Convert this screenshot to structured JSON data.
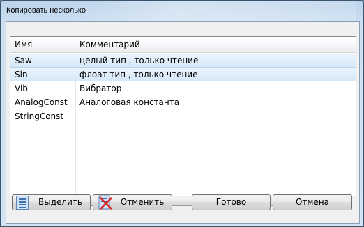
{
  "window": {
    "title": "Копировать несколько"
  },
  "grid": {
    "columns": [
      "Имя",
      "Комментарий"
    ],
    "rows": [
      {
        "name": "Saw",
        "comment": "целый тип , только чтение",
        "selected": true
      },
      {
        "name": "Sin",
        "comment": "флоат тип , только чтение",
        "selected": true
      },
      {
        "name": "Vib",
        "comment": "Вибратор",
        "selected": false
      },
      {
        "name": "AnalogConst",
        "comment": "Аналоговая константа",
        "selected": false
      },
      {
        "name": "StringConst",
        "comment": "",
        "selected": false
      }
    ]
  },
  "buttons": {
    "select": "Выделить",
    "deselect": "Отменить",
    "done": "Готово",
    "cancel": "Отмена"
  },
  "icons": {
    "select": "document-list-icon",
    "deselect": "document-cross-icon",
    "scroll_left": "arrow-left-icon",
    "scroll_right": "arrow-right-icon"
  },
  "colors": {
    "selection": "#d6e8f8",
    "window_frame": "#c6dbef"
  }
}
